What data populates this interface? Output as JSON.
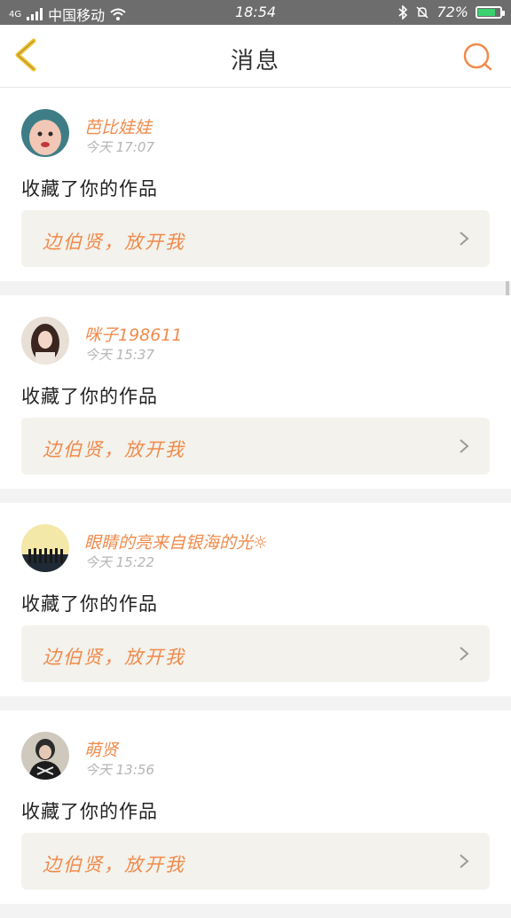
{
  "status_bar": {
    "carrier": "中国移动",
    "network": "4G",
    "time": "18:54",
    "battery": "72%"
  },
  "header": {
    "title": "消息",
    "back_icon": "chevron-left-icon",
    "search_icon": "search-icon"
  },
  "colors": {
    "accent": "#f08b4c",
    "back_yellow": "#f2c230",
    "card_bg": "#f3f2ec"
  },
  "messages": [
    {
      "user": "芭比娃娃",
      "time": "今天 17:07",
      "action": "收藏了你的作品",
      "work": "边伯贤，放开我"
    },
    {
      "user": "咪子198611",
      "time": "今天 15:37",
      "action": "收藏了你的作品",
      "work": "边伯贤，放开我"
    },
    {
      "user": "眼睛的亮来自银海的光☼",
      "time": "今天 15:22",
      "action": "收藏了你的作品",
      "work": "边伯贤，放开我"
    },
    {
      "user": "萌贤",
      "time": "今天 13:56",
      "action": "收藏了你的作品",
      "work": "边伯贤，放开我"
    }
  ]
}
